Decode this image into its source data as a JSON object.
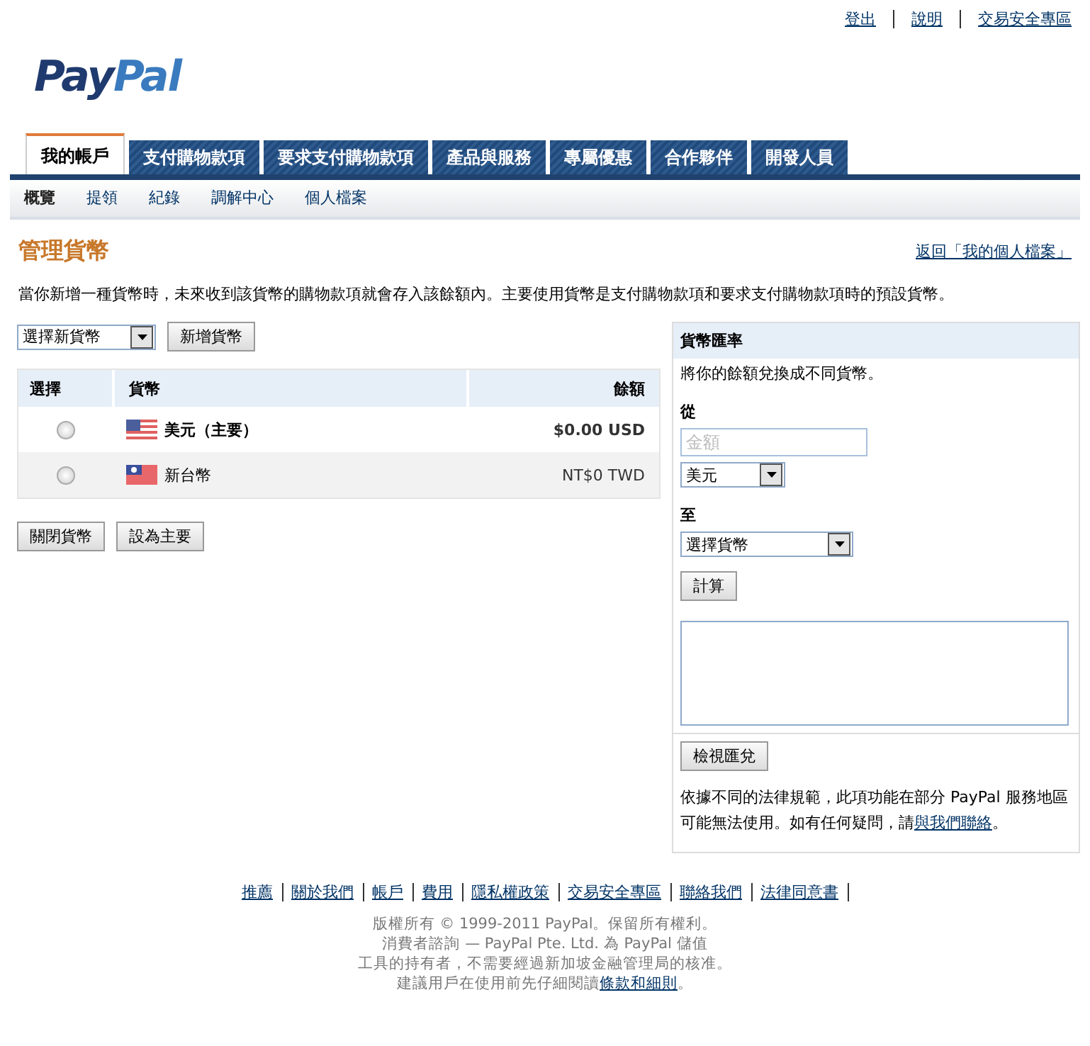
{
  "top_links": [
    "登出",
    "說明",
    "交易安全專區"
  ],
  "logo": {
    "first": "Pay",
    "second": "Pal"
  },
  "tabs": [
    {
      "label": "我的帳戶",
      "selected": true
    },
    {
      "label": "支付購物款項",
      "selected": false
    },
    {
      "label": "要求支付購物款項",
      "selected": false
    },
    {
      "label": "產品與服務",
      "selected": false
    },
    {
      "label": "專屬優惠",
      "selected": false
    },
    {
      "label": "合作夥伴",
      "selected": false
    },
    {
      "label": "開發人員",
      "selected": false
    }
  ],
  "subnav": [
    {
      "label": "概覽",
      "selected": true
    },
    {
      "label": "提領",
      "selected": false
    },
    {
      "label": "紀錄",
      "selected": false
    },
    {
      "label": "調解中心",
      "selected": false
    },
    {
      "label": "個人檔案",
      "selected": false
    }
  ],
  "heading": "管理貨幣",
  "back_link": "返回「我的個人檔案」",
  "description": "當你新增一種貨幣時，未來收到該貨幣的購物款項就會存入該餘額內。主要使用貨幣是支付購物款項和要求支付購物款項時的預設貨幣。",
  "currency_select": "選擇新貨幣",
  "add_button": "新增貨幣",
  "table": {
    "columns": [
      "選擇",
      "貨幣",
      "餘額"
    ],
    "rows": [
      {
        "selected": false,
        "currency": "美元（主要）",
        "balance": "$0.00 USD",
        "primary": true
      },
      {
        "selected": false,
        "currency": "新台幣",
        "balance": "NT$0 TWD",
        "primary": false
      }
    ]
  },
  "table_buttons": [
    "關閉貨幣",
    "設為主要"
  ],
  "converter": {
    "title": "貨幣匯率",
    "intro": "將你的餘額兌換成不同貨幣。",
    "from_label": "從",
    "amount_placeholder": "金額",
    "from_currency": "美元",
    "to_label": "至",
    "to_currency": "選擇貨幣",
    "calculate_button": "計算",
    "view_button": "檢視匯兌",
    "note": "依據不同的法律規範，此項功能在部分 PayPal 服務地區可能無法使用。如有任何疑問，請",
    "note_link": "與我們聯絡",
    "note_end": "。"
  },
  "footer_links": [
    "推薦",
    "關於我們",
    "帳戶",
    "費用",
    "隱私權政策",
    "交易安全專區",
    "聯絡我們",
    "法律同意書"
  ],
  "copyright": [
    "版權所有 © 1999-2011 PayPal。保留所有權利。",
    "消費者諮詢 — PayPal Pte. Ltd. 為 PayPal 儲值",
    "工具的持有者，不需要經過新加坡金融管理局的核准。"
  ],
  "terms": {
    "text": "建議用戶在使用前先仔細閱讀",
    "link": "條款和細則",
    "end": "。"
  }
}
